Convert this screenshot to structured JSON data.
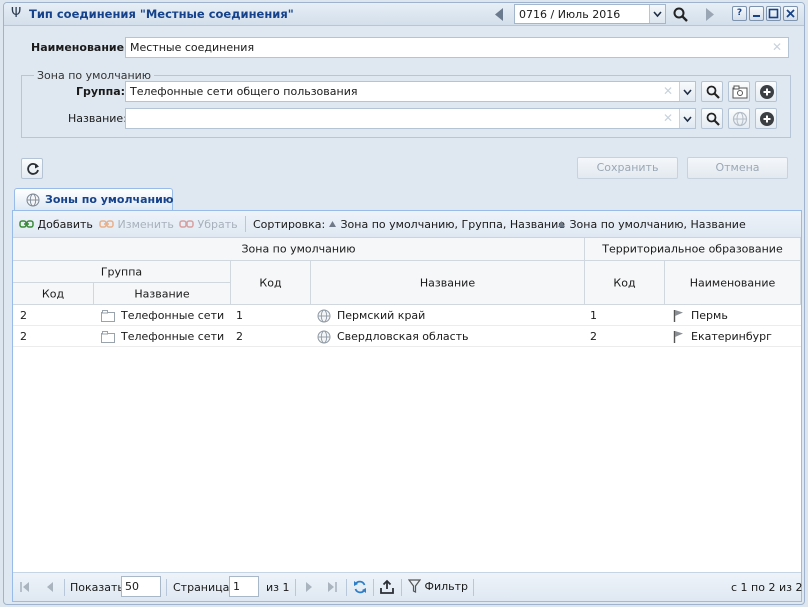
{
  "window": {
    "title": "Тип соединения \"Местные соединения\"",
    "period": "0716 / Июль 2016",
    "help_label": "?"
  },
  "form": {
    "name_label": "Наименование:",
    "name_value": "Местные соединения",
    "zone_legend": "Зона по умолчанию",
    "group_label": "Группа:",
    "group_value": "Телефонные сети общего пользования",
    "title_label": "Название:",
    "title_value": ""
  },
  "actions": {
    "save_label": "Сохранить",
    "cancel_label": "Отмена"
  },
  "tab": {
    "label": "Зоны по умолчанию"
  },
  "toolbar": {
    "add_label": "Добавить",
    "edit_label": "Изменить",
    "remove_label": "Убрать",
    "sort_label": "Сортировка:",
    "sort1_label": "Зона по умолчанию, Группа, Название",
    "sort2_label": "Зона по умолчанию, Название"
  },
  "grid": {
    "header_zone": "Зона по умолчанию",
    "header_territory": "Территориальное образование",
    "header_group": "Группа",
    "col_group_code": "Код",
    "col_group_name": "Название",
    "col_zone_code": "Код",
    "col_zone_name": "Название",
    "col_terr_code": "Код",
    "col_terr_name": "Наименование",
    "rows": [
      {
        "group_code": "2",
        "group_name": "Телефонные сети ...",
        "zone_code": "1",
        "zone_name": "Пермский край",
        "terr_code": "1",
        "terr_name": "Пермь"
      },
      {
        "group_code": "2",
        "group_name": "Телефонные сети ...",
        "zone_code": "2",
        "zone_name": "Свердловская область",
        "terr_code": "2",
        "terr_name": "Екатеринбург"
      }
    ]
  },
  "pager": {
    "show_label": "Показать",
    "page_size": "50",
    "page_label": "Страница",
    "page_value": "1",
    "of_label": "из 1",
    "filter_label": "Фильтр",
    "summary": "с 1 по 2 из 2"
  },
  "colors": {
    "title_text": "#15428b",
    "panel_border": "#99bbe8",
    "add_icon": "#3a8a3a",
    "disabled_icon": "#d9a0a0"
  }
}
